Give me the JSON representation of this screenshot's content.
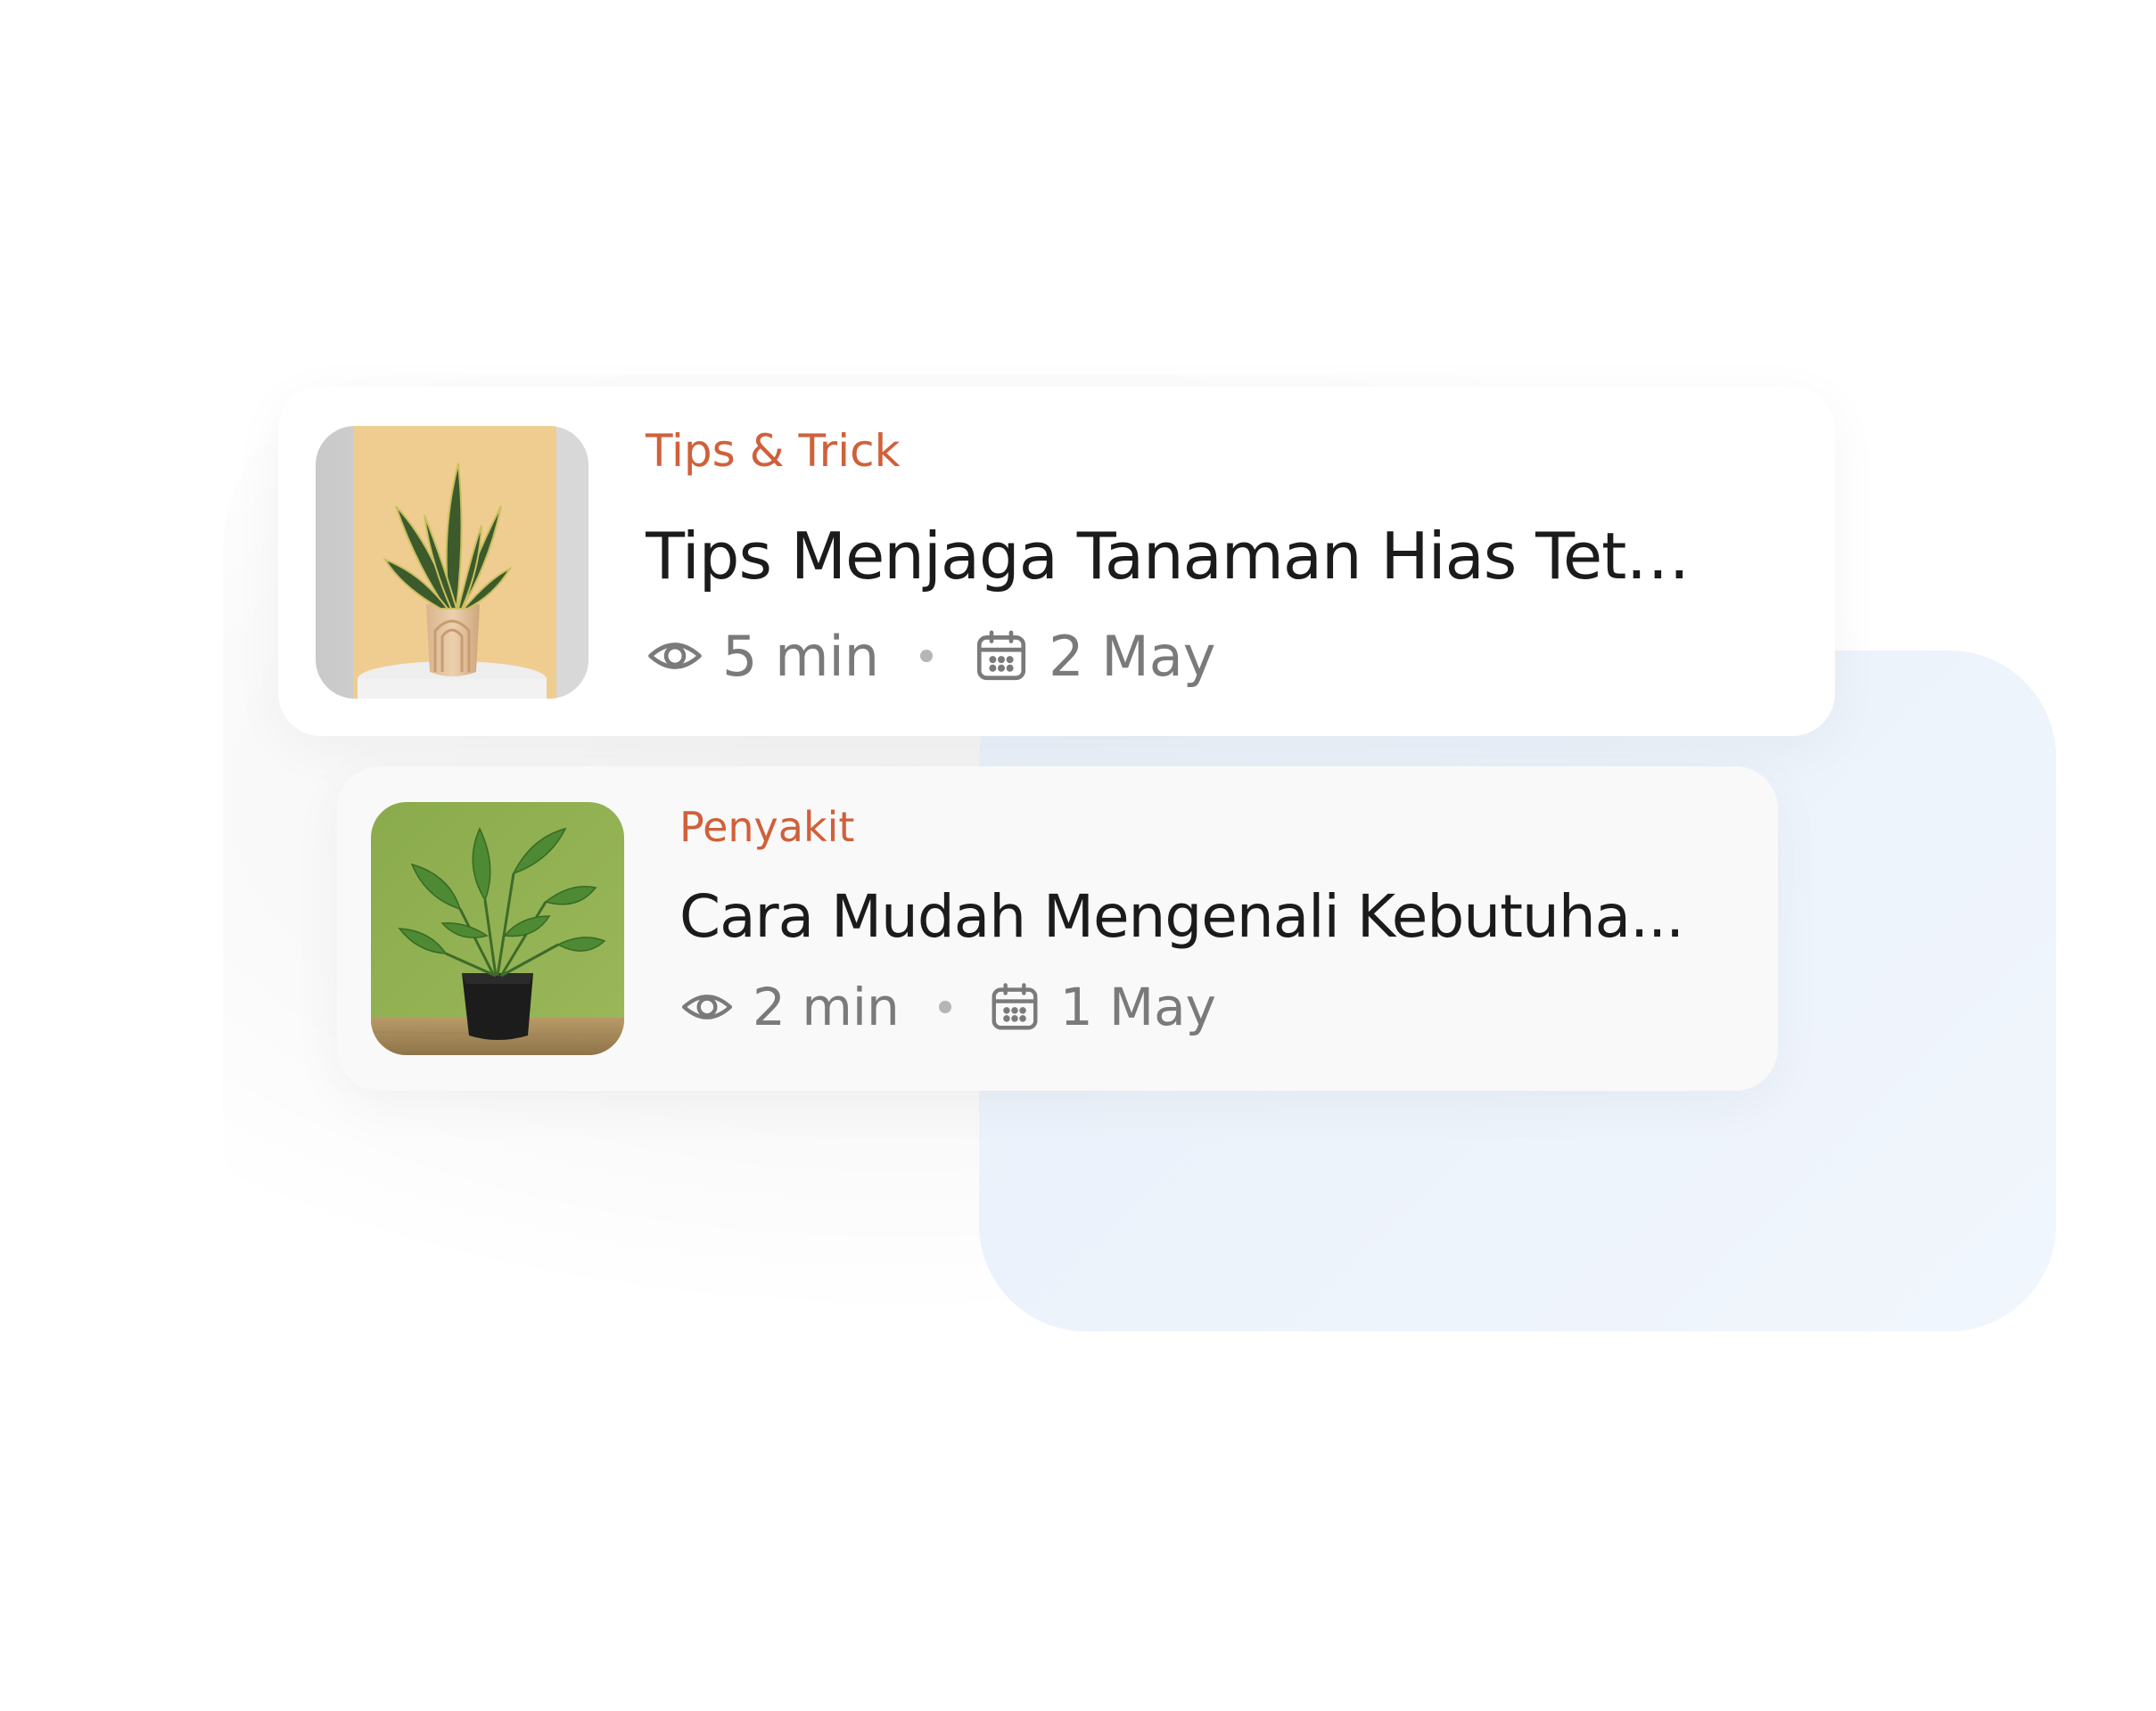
{
  "articles": [
    {
      "category": "Tips & Trick",
      "title": "Tips Menjaga Tanaman Hias Teta...",
      "read_time": "5 min",
      "date": "2 May",
      "image": "snake-plant-photo"
    },
    {
      "category": "Penyakit",
      "title": "Cara Mudah Mengenali Kebutuha...",
      "read_time": "2 min",
      "date": "1 May",
      "image": "bird-of-paradise-plant-photo"
    }
  ],
  "colors": {
    "category": "#d0603a",
    "title": "#1b1b1b",
    "meta": "#7a7a7a",
    "panel": "#edf3fb"
  },
  "icons": {
    "views": "eye-icon",
    "date": "calendar-icon"
  }
}
